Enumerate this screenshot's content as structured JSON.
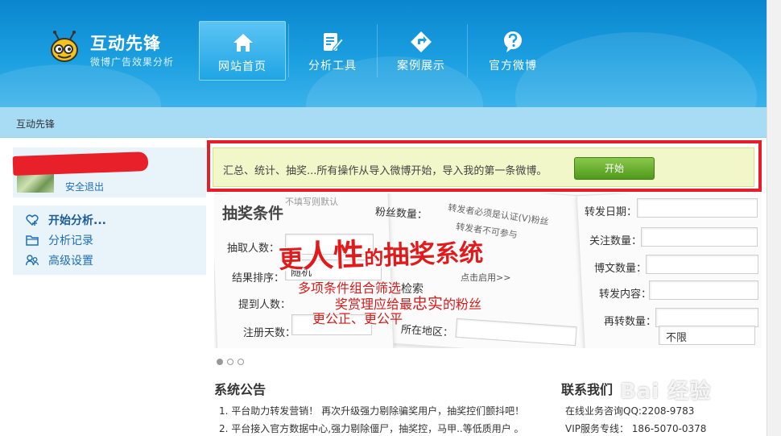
{
  "brand": {
    "title": "互动先锋",
    "subtitle": "微博广告效果分析"
  },
  "nav": [
    {
      "label": "网站首页",
      "icon": "home-icon",
      "active": true
    },
    {
      "label": "分析工具",
      "icon": "edit-doc-icon",
      "active": false
    },
    {
      "label": "案例展示",
      "icon": "diamond-arrow-icon",
      "active": false
    },
    {
      "label": "官方微博",
      "icon": "question-bubble-icon",
      "active": false
    }
  ],
  "breadcrumb": "互动先锋",
  "user": {
    "logout_label": "安全退出"
  },
  "menu": [
    {
      "label": "开始分析...",
      "icon": "heart-plus-icon"
    },
    {
      "label": "分析记录",
      "icon": "folder-icon"
    },
    {
      "label": "高级设置",
      "icon": "users-icon"
    }
  ],
  "notice": {
    "text": "汇总、统计、抽奖...所有操作从导入微博开始，导入我的第一条微博。",
    "button_label": "开始"
  },
  "banner": {
    "title": "抽奖条件",
    "hint": "不填写则默认",
    "labels": {
      "draw_count": "抽取人数：",
      "sort": "结果排序：",
      "mention": "提到人数：",
      "reg_days": "注册天数：",
      "fans": "粉丝数量：",
      "region": "所在地区：",
      "repost_date": "转发日期：",
      "follows": "关注数量：",
      "posts": "博文数量：",
      "repost_content": "转发内容：",
      "repost_count": "再转数量："
    },
    "sort_value": "随机",
    "unlimited_value": "不限",
    "note_lines": [
      "转发者必须是认证(V)粉丝",
      "转发者不可参与"
    ],
    "click_enable": "点击启用>>",
    "slogan": {
      "part1": "更",
      "big1": "人性",
      "part2": "的",
      "big2": "抽奖",
      "part3": "系统"
    },
    "sub1": "多项条件组合筛选",
    "sub1_suffix": "检索",
    "sub2a": "奖赏理应给最",
    "sub2b": "忠实",
    "sub2c": "的粉丝",
    "sub3": "更公正、更公平"
  },
  "carousel": {
    "count": 3,
    "active": 0
  },
  "announcements": {
    "title": "系统公告",
    "items": [
      "1. 平台助力转发营销！ 再次升级强力剔除骗奖用户，抽奖控们颤抖吧！",
      "2. 平台接入官方数据中心,强力剔除僵尸，抽奖控，马甲..等低质用户 。"
    ]
  },
  "contact": {
    "title": "联系我们",
    "lines": [
      "在线业务咨询QQ:2208-9783",
      "VIP服务专线： 186-5070-0378"
    ]
  },
  "watermark": "Bai 经验",
  "colors": {
    "header_blue": "#1b9fe0",
    "crumb_bar": "#a8dcf4",
    "highlight_red": "#e51e2a",
    "notice_bg": "#f1f7c8",
    "button_green": "#5fa82a",
    "link_blue": "#1f6fb5"
  }
}
